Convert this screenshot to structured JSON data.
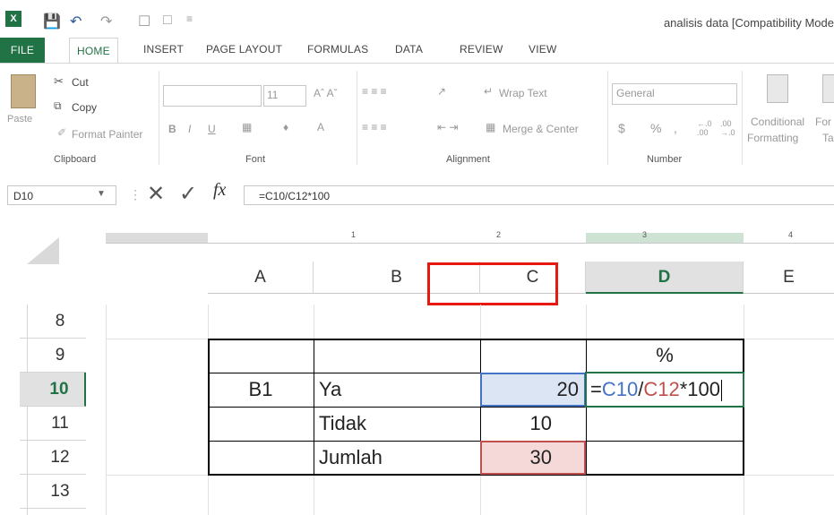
{
  "title_bar": {
    "title": "analisis data  [Compatibility Mode"
  },
  "tabs": [
    "FILE",
    "HOME",
    "INSERT",
    "PAGE LAYOUT",
    "FORMULAS",
    "DATA",
    "REVIEW",
    "VIEW"
  ],
  "ribbon": {
    "clipboard": {
      "paste": "Paste",
      "cut": "Cut",
      "copy": "Copy",
      "format_painter": "Format Painter",
      "label": "Clipboard"
    },
    "font": {
      "size": "11",
      "bold": "B",
      "italic": "I",
      "underline": "U",
      "label": "Font"
    },
    "alignment": {
      "wrap_text": "Wrap Text",
      "merge_center": "Merge & Center",
      "label": "Alignment"
    },
    "number": {
      "format": "General",
      "currency": "$",
      "percent": "%",
      "comma": ",",
      "label": "Number"
    },
    "styles": {
      "conditional": "Conditional",
      "formatting": "Formatting",
      "fo": "For",
      "ta": "Ta"
    }
  },
  "formula_bar": {
    "name_box": "D10",
    "fx": "fx",
    "formula": "=C10/C12*100"
  },
  "ruler": [
    "1",
    "2",
    "3",
    "4"
  ],
  "columns": [
    "A",
    "B",
    "C",
    "D",
    "E"
  ],
  "rows": [
    "8",
    "9",
    "10",
    "11",
    "12",
    "13"
  ],
  "cells": {
    "d9": "%",
    "a10": "B1",
    "b10": "Ya",
    "c10": "20",
    "d10_eq": "=",
    "d10_ref1": "C10",
    "d10_div": "/",
    "d10_ref2": "C12",
    "d10_rest": "*100",
    "b11": "Tidak",
    "c11": "10",
    "b12": "Jumlah",
    "c12": "30"
  },
  "colors": {
    "excel_green": "#217346",
    "ref_blue": "#4472c4",
    "ref_red": "#c0504d",
    "highlight_red": "#e8170f"
  }
}
